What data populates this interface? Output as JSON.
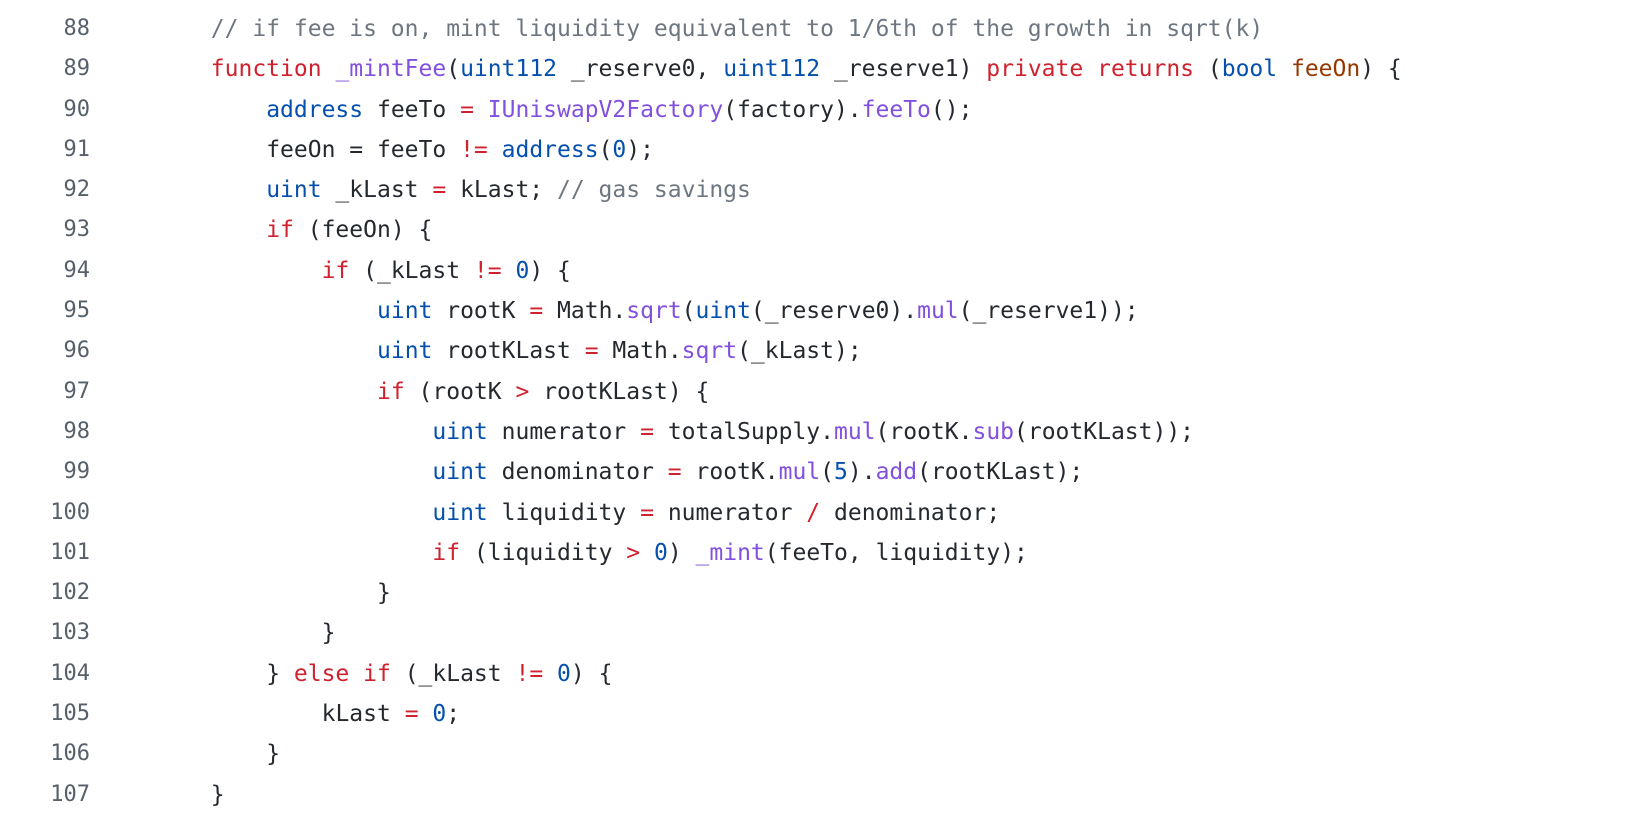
{
  "code_view": {
    "lines": [
      {
        "number": "88",
        "indent": 2,
        "tokens": [
          {
            "t": "// if fee is on, mint liquidity equivalent to 1/6th of the growth in sqrt(k)",
            "k": "com"
          }
        ]
      },
      {
        "number": "89",
        "indent": 2,
        "tokens": [
          {
            "t": "function",
            "k": "kw"
          },
          {
            "t": " ",
            "k": "id"
          },
          {
            "t": "_mintFee",
            "k": "fn"
          },
          {
            "t": "(",
            "k": "id"
          },
          {
            "t": "uint112",
            "k": "type"
          },
          {
            "t": " _reserve0, ",
            "k": "id"
          },
          {
            "t": "uint112",
            "k": "type"
          },
          {
            "t": " _reserve1) ",
            "k": "id"
          },
          {
            "t": "private",
            "k": "kw"
          },
          {
            "t": " ",
            "k": "id"
          },
          {
            "t": "returns",
            "k": "kw"
          },
          {
            "t": " (",
            "k": "id"
          },
          {
            "t": "bool",
            "k": "type"
          },
          {
            "t": " ",
            "k": "id"
          },
          {
            "t": "feeOn",
            "k": "param"
          },
          {
            "t": ") {",
            "k": "id"
          }
        ]
      },
      {
        "number": "90",
        "indent": 3,
        "tokens": [
          {
            "t": "address",
            "k": "type"
          },
          {
            "t": " feeTo ",
            "k": "id"
          },
          {
            "t": "=",
            "k": "op"
          },
          {
            "t": " ",
            "k": "id"
          },
          {
            "t": "IUniswapV2Factory",
            "k": "fn"
          },
          {
            "t": "(factory).",
            "k": "id"
          },
          {
            "t": "feeTo",
            "k": "fn"
          },
          {
            "t": "();",
            "k": "id"
          }
        ]
      },
      {
        "number": "91",
        "indent": 3,
        "tokens": [
          {
            "t": "feeOn = feeTo ",
            "k": "id"
          },
          {
            "t": "!=",
            "k": "op"
          },
          {
            "t": " ",
            "k": "id"
          },
          {
            "t": "address",
            "k": "type"
          },
          {
            "t": "(",
            "k": "id"
          },
          {
            "t": "0",
            "k": "num"
          },
          {
            "t": ");",
            "k": "id"
          }
        ]
      },
      {
        "number": "92",
        "indent": 3,
        "tokens": [
          {
            "t": "uint",
            "k": "type"
          },
          {
            "t": " _kLast ",
            "k": "id"
          },
          {
            "t": "=",
            "k": "op"
          },
          {
            "t": " kLast; ",
            "k": "id"
          },
          {
            "t": "// gas savings",
            "k": "com"
          }
        ]
      },
      {
        "number": "93",
        "indent": 3,
        "tokens": [
          {
            "t": "if",
            "k": "kw"
          },
          {
            "t": " (feeOn) {",
            "k": "id"
          }
        ]
      },
      {
        "number": "94",
        "indent": 4,
        "tokens": [
          {
            "t": "if",
            "k": "kw"
          },
          {
            "t": " (_kLast ",
            "k": "id"
          },
          {
            "t": "!=",
            "k": "op"
          },
          {
            "t": " ",
            "k": "id"
          },
          {
            "t": "0",
            "k": "num"
          },
          {
            "t": ") {",
            "k": "id"
          }
        ]
      },
      {
        "number": "95",
        "indent": 5,
        "tokens": [
          {
            "t": "uint",
            "k": "type"
          },
          {
            "t": " rootK ",
            "k": "id"
          },
          {
            "t": "=",
            "k": "op"
          },
          {
            "t": " Math.",
            "k": "id"
          },
          {
            "t": "sqrt",
            "k": "fn"
          },
          {
            "t": "(",
            "k": "id"
          },
          {
            "t": "uint",
            "k": "type"
          },
          {
            "t": "(_reserve0).",
            "k": "id"
          },
          {
            "t": "mul",
            "k": "fn"
          },
          {
            "t": "(_reserve1));",
            "k": "id"
          }
        ]
      },
      {
        "number": "96",
        "indent": 5,
        "tokens": [
          {
            "t": "uint",
            "k": "type"
          },
          {
            "t": " rootKLast ",
            "k": "id"
          },
          {
            "t": "=",
            "k": "op"
          },
          {
            "t": " Math.",
            "k": "id"
          },
          {
            "t": "sqrt",
            "k": "fn"
          },
          {
            "t": "(_kLast);",
            "k": "id"
          }
        ]
      },
      {
        "number": "97",
        "indent": 5,
        "tokens": [
          {
            "t": "if",
            "k": "kw"
          },
          {
            "t": " (rootK ",
            "k": "id"
          },
          {
            "t": ">",
            "k": "op"
          },
          {
            "t": " rootKLast) {",
            "k": "id"
          }
        ]
      },
      {
        "number": "98",
        "indent": 6,
        "tokens": [
          {
            "t": "uint",
            "k": "type"
          },
          {
            "t": " numerator ",
            "k": "id"
          },
          {
            "t": "=",
            "k": "op"
          },
          {
            "t": " totalSupply.",
            "k": "id"
          },
          {
            "t": "mul",
            "k": "fn"
          },
          {
            "t": "(rootK.",
            "k": "id"
          },
          {
            "t": "sub",
            "k": "fn"
          },
          {
            "t": "(rootKLast));",
            "k": "id"
          }
        ]
      },
      {
        "number": "99",
        "indent": 6,
        "tokens": [
          {
            "t": "uint",
            "k": "type"
          },
          {
            "t": " denominator ",
            "k": "id"
          },
          {
            "t": "=",
            "k": "op"
          },
          {
            "t": " rootK.",
            "k": "id"
          },
          {
            "t": "mul",
            "k": "fn"
          },
          {
            "t": "(",
            "k": "id"
          },
          {
            "t": "5",
            "k": "num"
          },
          {
            "t": ").",
            "k": "id"
          },
          {
            "t": "add",
            "k": "fn"
          },
          {
            "t": "(rootKLast);",
            "k": "id"
          }
        ]
      },
      {
        "number": "100",
        "indent": 6,
        "tokens": [
          {
            "t": "uint",
            "k": "type"
          },
          {
            "t": " liquidity ",
            "k": "id"
          },
          {
            "t": "=",
            "k": "op"
          },
          {
            "t": " numerator ",
            "k": "id"
          },
          {
            "t": "/",
            "k": "op"
          },
          {
            "t": " denominator;",
            "k": "id"
          }
        ]
      },
      {
        "number": "101",
        "indent": 6,
        "tokens": [
          {
            "t": "if",
            "k": "kw"
          },
          {
            "t": " (liquidity ",
            "k": "id"
          },
          {
            "t": ">",
            "k": "op"
          },
          {
            "t": " ",
            "k": "id"
          },
          {
            "t": "0",
            "k": "num"
          },
          {
            "t": ") ",
            "k": "id"
          },
          {
            "t": "_mint",
            "k": "fn"
          },
          {
            "t": "(feeTo, liquidity);",
            "k": "id"
          }
        ]
      },
      {
        "number": "102",
        "indent": 5,
        "tokens": [
          {
            "t": "}",
            "k": "id"
          }
        ]
      },
      {
        "number": "103",
        "indent": 4,
        "tokens": [
          {
            "t": "}",
            "k": "id"
          }
        ]
      },
      {
        "number": "104",
        "indent": 3,
        "tokens": [
          {
            "t": "} ",
            "k": "id"
          },
          {
            "t": "else",
            "k": "kw"
          },
          {
            "t": " ",
            "k": "id"
          },
          {
            "t": "if",
            "k": "kw"
          },
          {
            "t": " (_kLast ",
            "k": "id"
          },
          {
            "t": "!=",
            "k": "op"
          },
          {
            "t": " ",
            "k": "id"
          },
          {
            "t": "0",
            "k": "num"
          },
          {
            "t": ") {",
            "k": "id"
          }
        ]
      },
      {
        "number": "105",
        "indent": 4,
        "tokens": [
          {
            "t": "kLast ",
            "k": "id"
          },
          {
            "t": "=",
            "k": "op"
          },
          {
            "t": " ",
            "k": "id"
          },
          {
            "t": "0",
            "k": "num"
          },
          {
            "t": ";",
            "k": "id"
          }
        ]
      },
      {
        "number": "106",
        "indent": 3,
        "tokens": [
          {
            "t": "}",
            "k": "id"
          }
        ]
      },
      {
        "number": "107",
        "indent": 2,
        "tokens": [
          {
            "t": "}",
            "k": "id"
          }
        ]
      }
    ]
  }
}
